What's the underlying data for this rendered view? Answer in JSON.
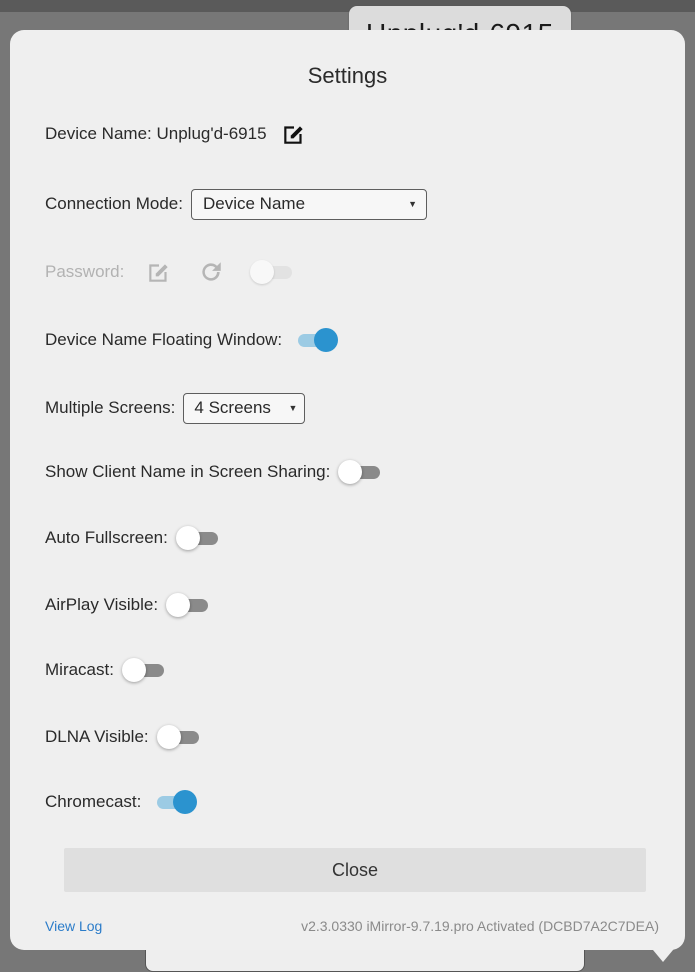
{
  "background_tab": {
    "title": "Unplug'd-6915"
  },
  "dialog": {
    "title": "Settings",
    "device_name": {
      "label": "Device Name: Unplug'd-6915",
      "icon": "edit-icon"
    },
    "connection_mode": {
      "label": "Connection Mode:",
      "selected": "Device Name"
    },
    "password": {
      "label": "Password:",
      "enabled": false,
      "edit_icon": "edit-icon",
      "refresh_icon": "refresh-icon",
      "toggle_on": false
    },
    "floating_window": {
      "label": "Device Name Floating Window:",
      "toggle_on": true
    },
    "multiple_screens": {
      "label": "Multiple Screens:",
      "selected": "4 Screens"
    },
    "show_client_name": {
      "label": "Show Client Name in Screen Sharing:",
      "toggle_on": false
    },
    "auto_fullscreen": {
      "label": "Auto Fullscreen:",
      "toggle_on": false
    },
    "airplay_visible": {
      "label": "AirPlay Visible:",
      "toggle_on": false
    },
    "miracast": {
      "label": "Miracast:",
      "toggle_on": false
    },
    "dlna_visible": {
      "label": "DLNA Visible:",
      "toggle_on": false
    },
    "chromecast": {
      "label": "Chromecast:",
      "toggle_on": true
    },
    "close_label": "Close",
    "view_log_label": "View Log",
    "version_text": "v2.3.0330 iMirror-9.7.19.pro Activated (DCBD7A2C7DEA)"
  },
  "colors": {
    "accent": "#2b93cf",
    "accent_track": "#9ccbe4",
    "link": "#2b7cc9",
    "dialog_bg": "#efefef"
  }
}
